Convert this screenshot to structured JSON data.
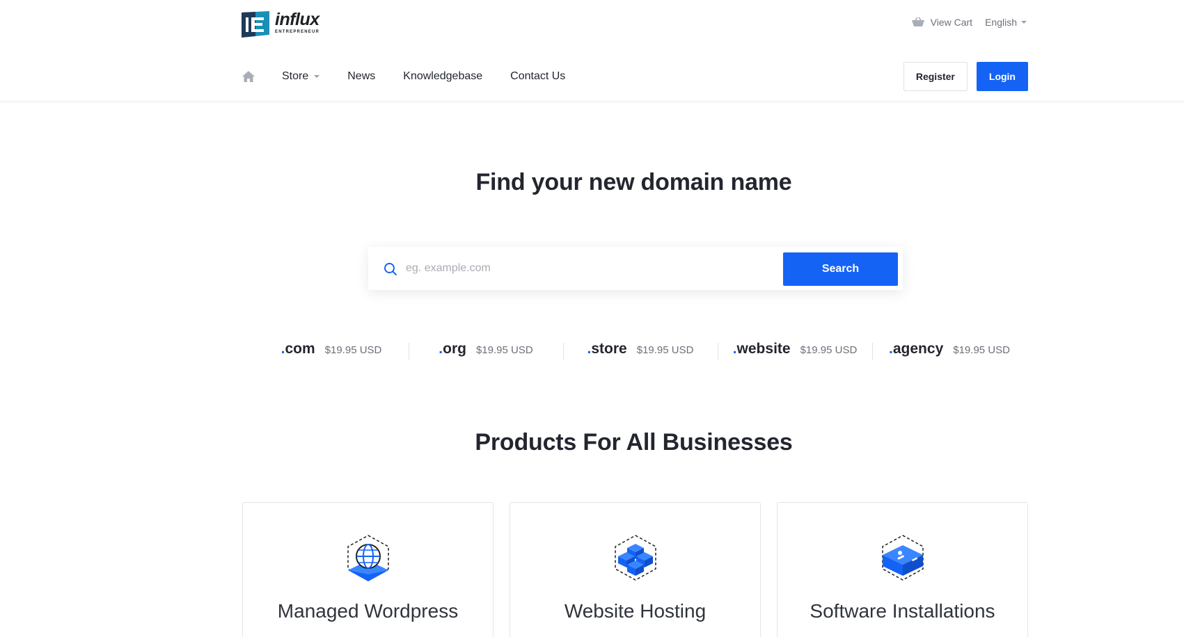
{
  "brand": {
    "name": "influx",
    "tagline": "ENTREPRENEUR",
    "accent_color": "#1463f5",
    "logo_mark_color": "#1b8fb8"
  },
  "top_bar": {
    "cart_icon": "basket-icon",
    "cart_label": "View Cart",
    "language_label": "English"
  },
  "nav": {
    "home_icon": "home-icon",
    "items": [
      {
        "label": "Store",
        "has_dropdown": true
      },
      {
        "label": "News"
      },
      {
        "label": "Knowledgebase"
      },
      {
        "label": "Contact Us"
      }
    ]
  },
  "auth": {
    "register_label": "Register",
    "login_label": "Login"
  },
  "hero": {
    "title": "Find your new domain name",
    "search_placeholder": "eg. example.com",
    "search_value": "",
    "search_button": "Search"
  },
  "tlds": [
    {
      "name": "com",
      "price": "$19.95 USD"
    },
    {
      "name": "org",
      "price": "$19.95 USD"
    },
    {
      "name": "store",
      "price": "$19.95 USD"
    },
    {
      "name": "website",
      "price": "$19.95 USD"
    },
    {
      "name": "agency",
      "price": "$19.95 USD"
    }
  ],
  "products": {
    "title": "Products For All Businesses",
    "cards": [
      {
        "title": "Managed Wordpress",
        "icon": "globe-cube-icon"
      },
      {
        "title": "Website Hosting",
        "icon": "stacked-cubes-icon"
      },
      {
        "title": "Software Installations",
        "icon": "server-box-icon"
      }
    ]
  }
}
